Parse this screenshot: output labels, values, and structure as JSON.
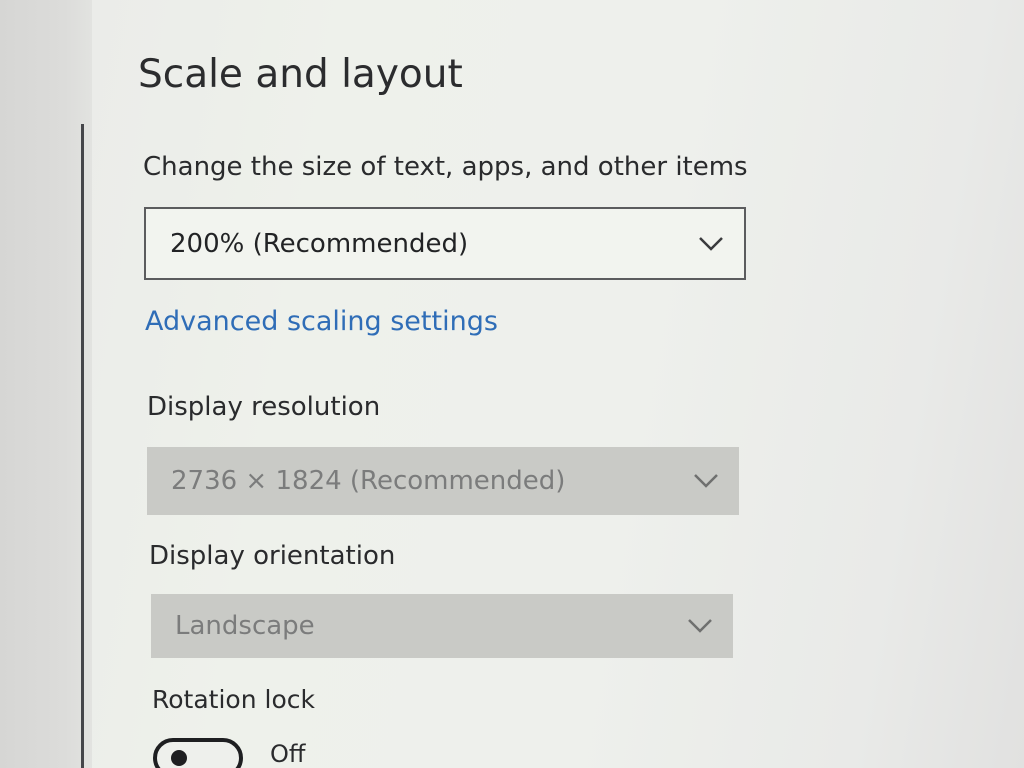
{
  "section": {
    "title": "Scale and layout"
  },
  "scale": {
    "label": "Change the size of text, apps, and other items",
    "value": "200% (Recommended)"
  },
  "advanced_link": "Advanced scaling settings",
  "resolution": {
    "label": "Display resolution",
    "value": "2736 × 1824 (Recommended)",
    "enabled": false
  },
  "orientation": {
    "label": "Display orientation",
    "value": "Landscape",
    "enabled": false
  },
  "rotation_lock": {
    "label": "Rotation lock",
    "state": "Off"
  },
  "colors": {
    "link": "#2f6db7",
    "disabled_field": "#c9cac6",
    "text": "#2a2b2d"
  },
  "icons": {
    "dropdown": "chevron-down-icon"
  }
}
